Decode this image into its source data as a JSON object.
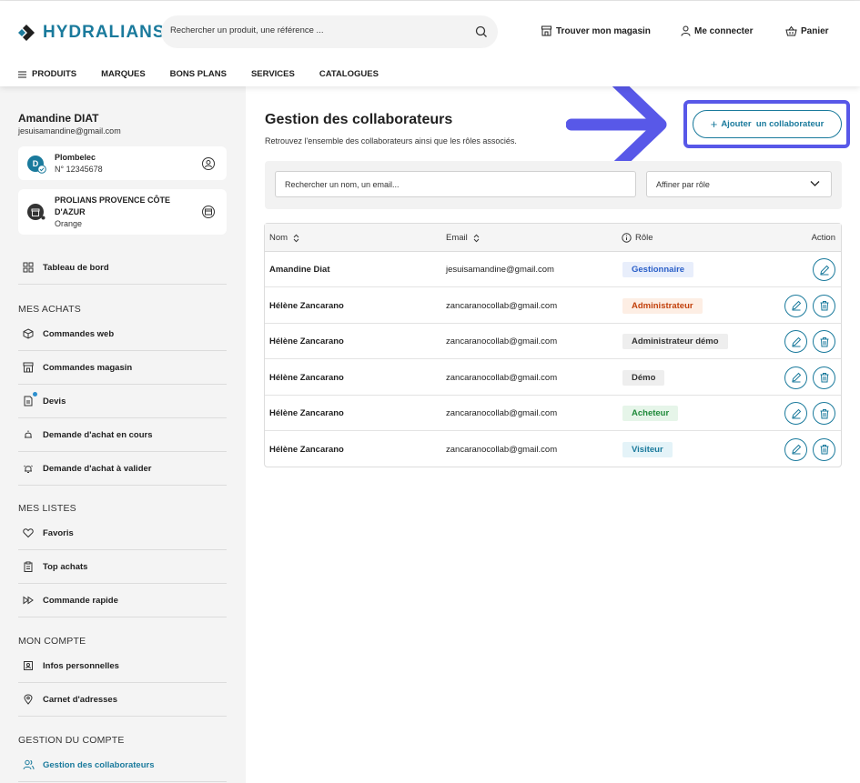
{
  "header": {
    "logo_text": "HYDRALIANS",
    "search_placeholder": "Rechercher un produit, une référence ...",
    "store_link": "Trouver mon magasin",
    "login_link": "Me connecter",
    "cart_link": "Panier",
    "nav": [
      "PRODUITS",
      "MARQUES",
      "BONS PLANS",
      "SERVICES",
      "CATALOGUES"
    ]
  },
  "sidebar": {
    "user_name": "Amandine DIAT",
    "user_email": "jesuisamandine@gmail.com",
    "accounts": [
      {
        "avatar": "D",
        "title": "Plombelec",
        "sub": "N° 12345678"
      },
      {
        "avatar": "",
        "title": "PROLIANS PROVENCE CÔTE D'AZUR",
        "sub": "Orange"
      }
    ],
    "dashboard": "Tableau de bord",
    "sections": [
      {
        "title": "MES ACHATS",
        "items": [
          "Commandes web",
          "Commandes magasin",
          "Devis",
          "Demande d'achat en cours",
          "Demande d'achat à valider"
        ]
      },
      {
        "title": "MES LISTES",
        "items": [
          "Favoris",
          "Top achats",
          "Commande rapide"
        ]
      },
      {
        "title": "MON COMPTE",
        "items": [
          "Infos personnelles",
          "Carnet d'adresses"
        ]
      },
      {
        "title": "GESTION DU COMPTE",
        "items": [
          "Gestion des collaborateurs"
        ]
      }
    ]
  },
  "main": {
    "title": "Gestion des collaborateurs",
    "subtitle": "Retrouvez l'ensemble des collaborateurs ainsi que les rôles associés.",
    "add_button": "Ajouter  un collaborateur",
    "search_placeholder": "Rechercher un nom, un email...",
    "role_filter": "Affiner par rôle",
    "columns": {
      "name": "Nom",
      "email": "Email",
      "role": "Rôle",
      "action": "Action"
    },
    "rows": [
      {
        "name": "Amandine Diat",
        "email": "jesuisamandine@gmail.com",
        "role": "Gestionnaire",
        "color": "#2a5fc8",
        "bg": "#e8eefb",
        "delete": false
      },
      {
        "name": "Hélène Zancarano",
        "email": "zancaranocollab@gmail.com",
        "role": "Administrateur",
        "color": "#c2410c",
        "bg": "#fdeee4",
        "delete": true
      },
      {
        "name": "Hélène Zancarano",
        "email": "zancaranocollab@gmail.com",
        "role": "Administrateur démo",
        "color": "#333333",
        "bg": "#eeeeee",
        "delete": true
      },
      {
        "name": "Hélène Zancarano",
        "email": "zancaranocollab@gmail.com",
        "role": "Démo",
        "color": "#333333",
        "bg": "#eeeeee",
        "delete": true
      },
      {
        "name": "Hélène Zancarano",
        "email": "zancaranocollab@gmail.com",
        "role": "Acheteur",
        "color": "#1f8a3a",
        "bg": "#e6f5e9",
        "delete": true
      },
      {
        "name": "Hélène Zancarano",
        "email": "zancaranocollab@gmail.com",
        "role": "Visiteur",
        "color": "#1a7a9c",
        "bg": "#e4f3f8",
        "delete": true
      }
    ]
  },
  "colors": {
    "brand": "#1a7a9c",
    "highlight": "#5858e8"
  }
}
